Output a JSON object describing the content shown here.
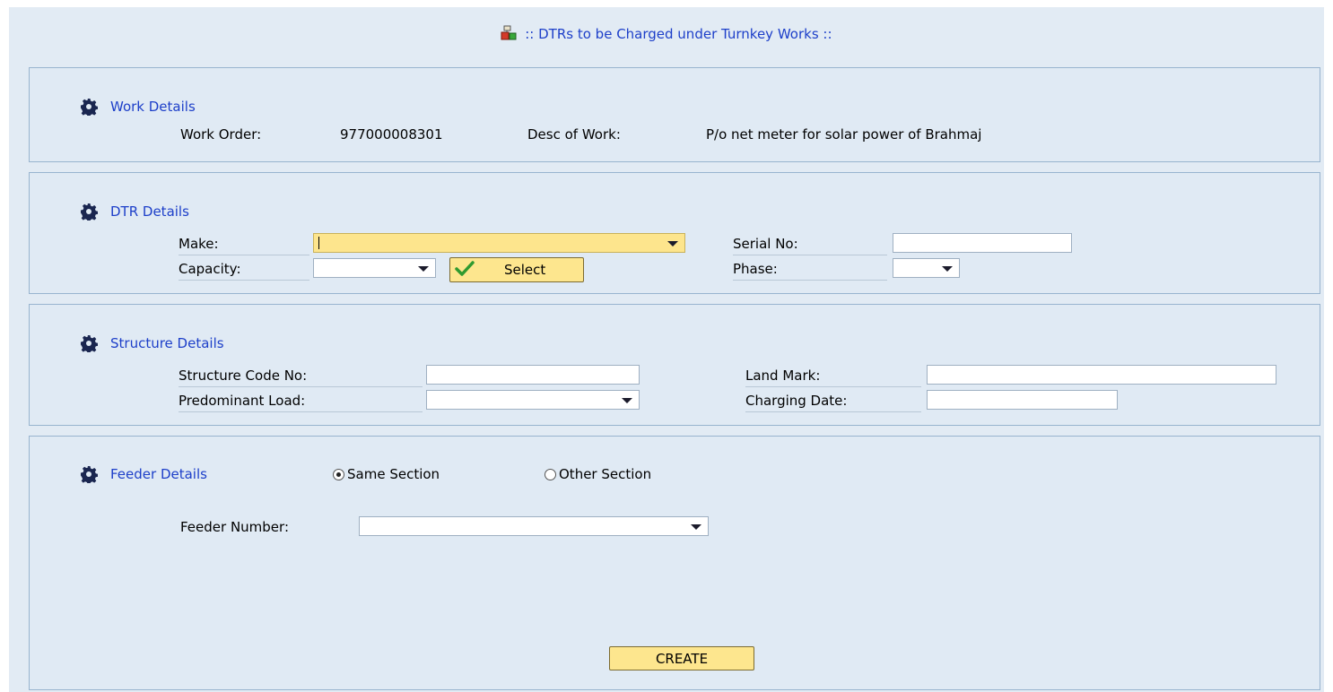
{
  "page": {
    "title": ":: DTRs to be Charged under Turnkey Works ::"
  },
  "work_details": {
    "title": "Work Details",
    "work_order_label": "Work Order:",
    "work_order_value": "977000008301",
    "desc_label": "Desc of Work:",
    "desc_value": "P/o net meter for solar power of Brahmaj"
  },
  "dtr_details": {
    "title": "DTR Details",
    "make_label": "Make:",
    "make_value": "",
    "capacity_label": "Capacity:",
    "capacity_value": "",
    "select_button": "Select",
    "serial_label": "Serial No:",
    "serial_value": "",
    "phase_label": "Phase:",
    "phase_value": ""
  },
  "structure_details": {
    "title": "Structure Details",
    "code_label": "Structure Code No:",
    "code_value": "",
    "load_label": "Predominant Load:",
    "load_value": "",
    "landmark_label": "Land Mark:",
    "landmark_value": "",
    "charging_label": "Charging Date:",
    "charging_value": ""
  },
  "feeder_details": {
    "title": "Feeder Details",
    "same_section_label": "Same Section",
    "other_section_label": "Other Section",
    "selected": "same_section",
    "feeder_number_label": "Feeder Number:",
    "feeder_number_value": ""
  },
  "actions": {
    "create_button": "CREATE"
  },
  "colors": {
    "background": "#e2ebf4",
    "panel_border": "#98b4cf",
    "section_title": "#1d3fc9",
    "button_fill": "#fde68e",
    "focus_field": "#fde58d"
  },
  "icons": {
    "title": "transformer-icon",
    "section": "gear-icon",
    "select": "checkmark-icon",
    "dropdown": "chevron-down-icon"
  }
}
